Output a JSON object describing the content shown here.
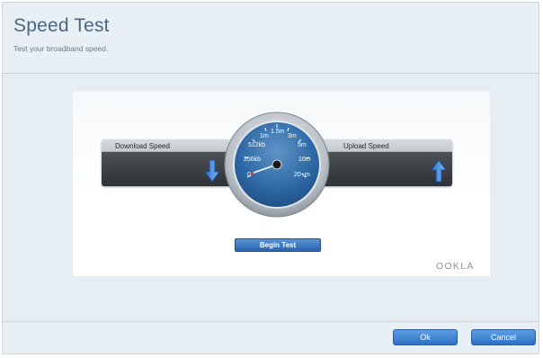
{
  "header": {
    "title": "Speed Test",
    "subtitle": "Test your broadband speed."
  },
  "speedtest": {
    "download_label": "Download Speed",
    "upload_label": "Upload Speed",
    "begin_label": "Begin Test",
    "provider_logo": "OOKLA",
    "gauge_ticks": [
      "0",
      "256kb",
      "512kb",
      "1m",
      "1.5m",
      "3m",
      "5m",
      "10m",
      "20+m"
    ],
    "download_icon": "arrow-down-icon",
    "upload_icon": "arrow-up-icon"
  },
  "footer": {
    "ok_label": "Ok",
    "cancel_label": "Cancel"
  },
  "colors": {
    "title": "#4a6782",
    "button": "#2d6fc4",
    "gauge_face": "#2f6aa6"
  }
}
